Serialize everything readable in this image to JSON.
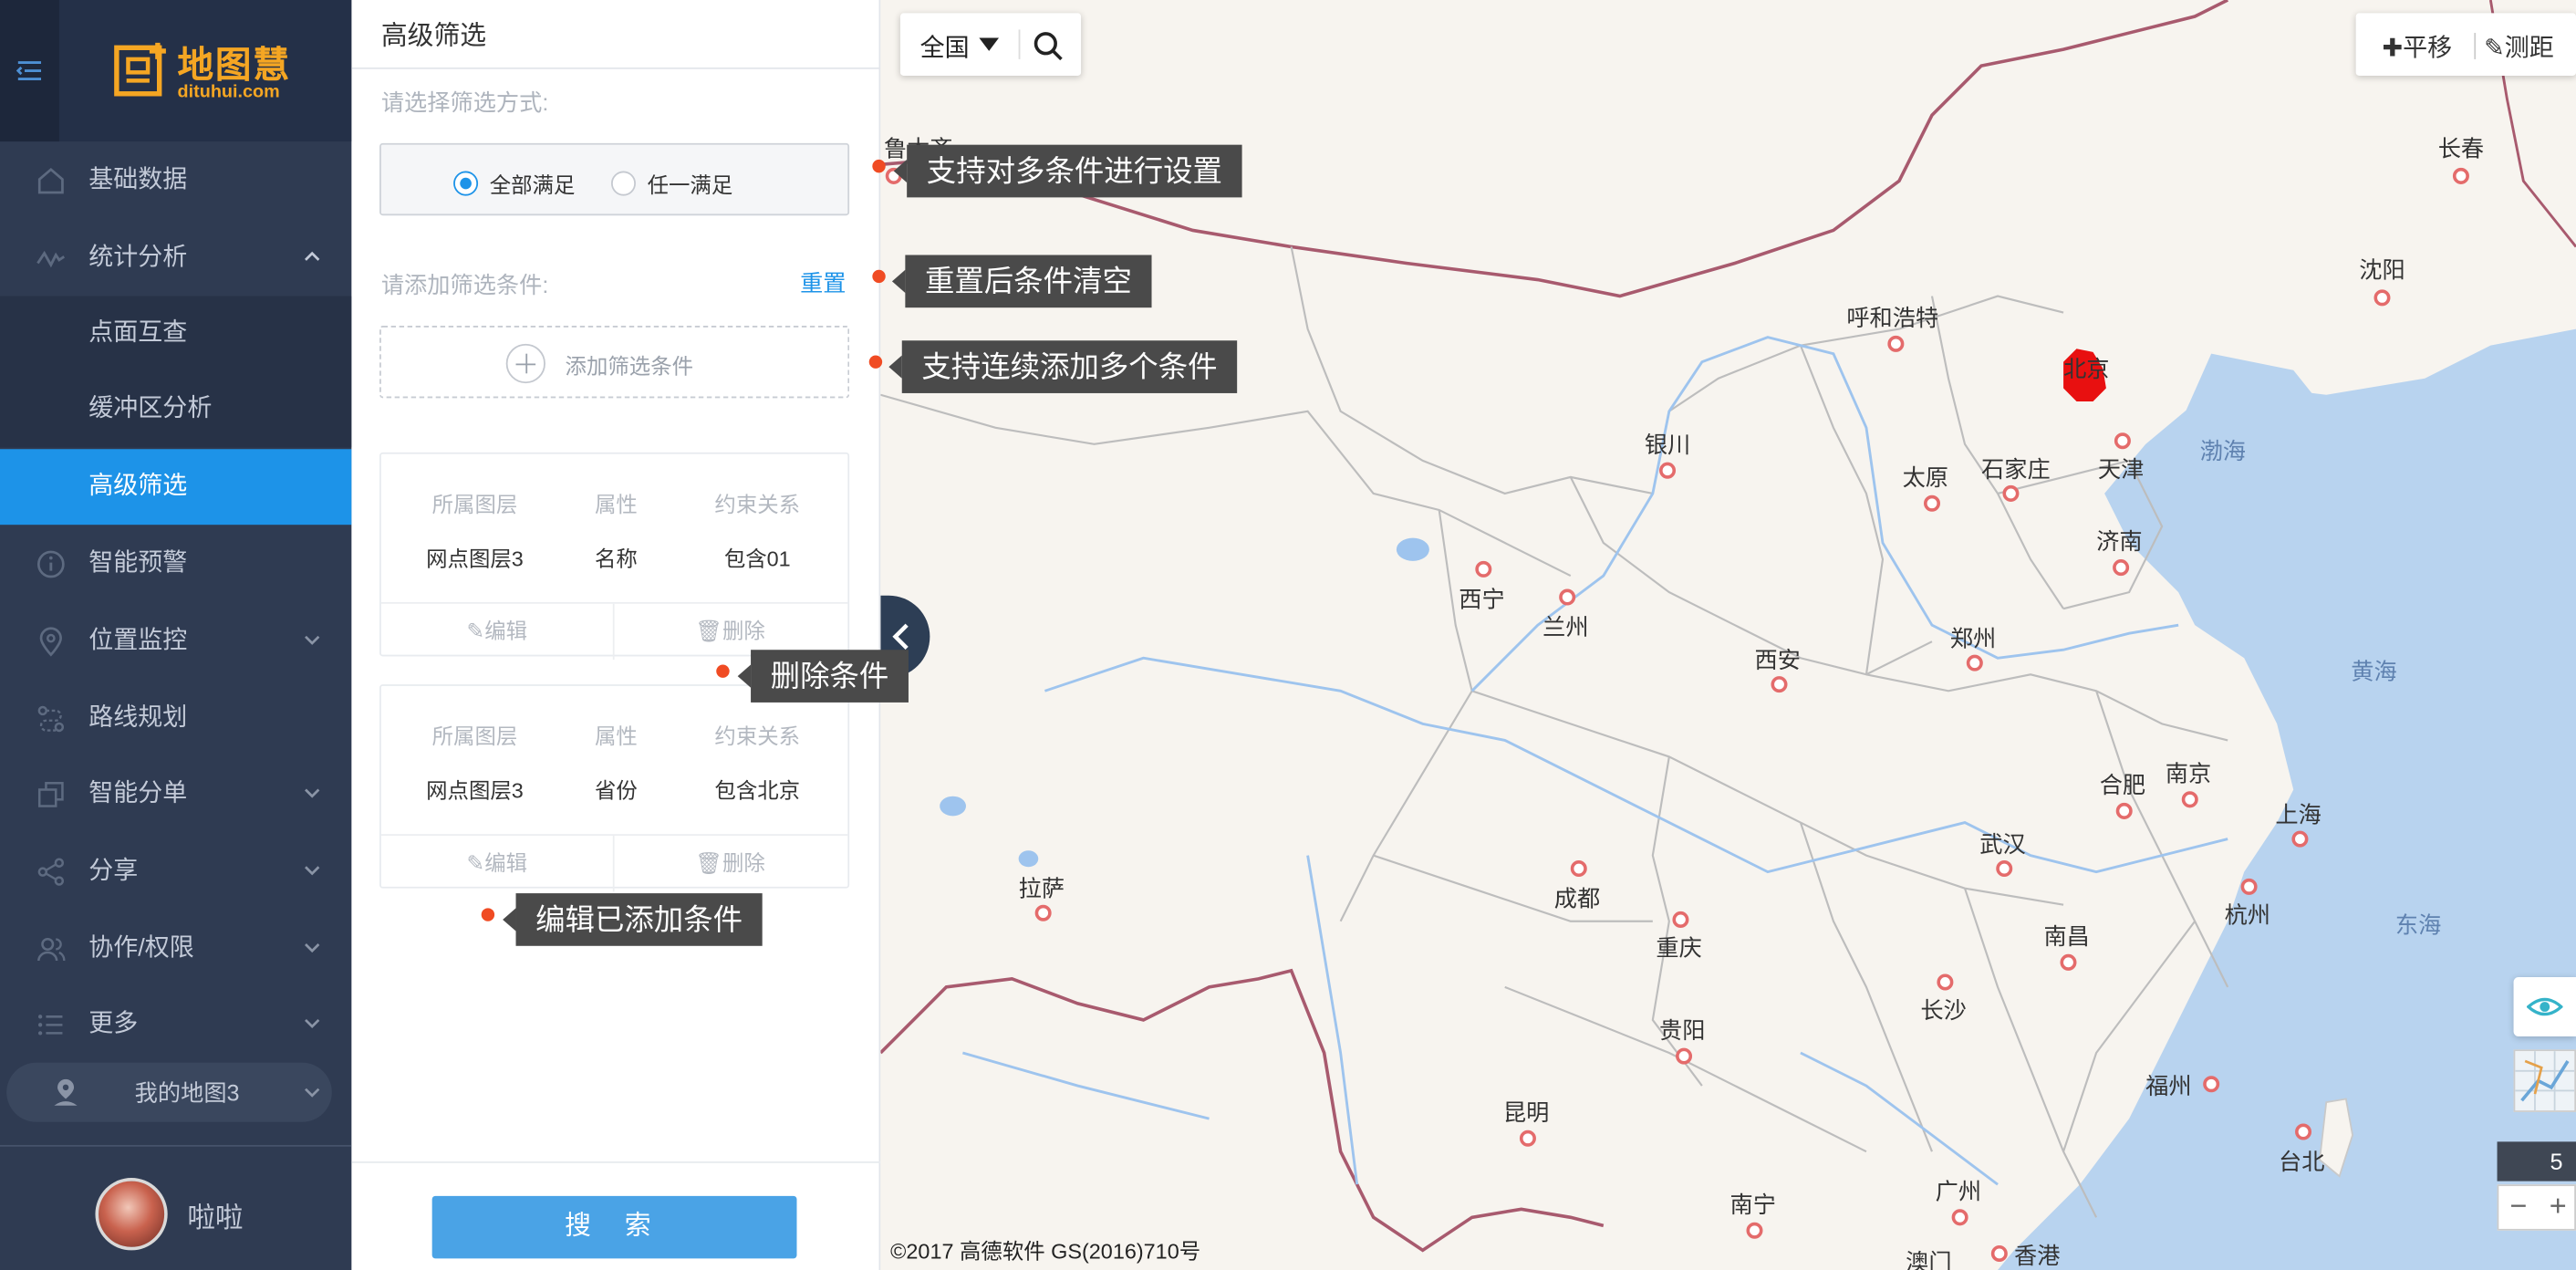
{
  "app": {
    "logo_name": "地图慧",
    "logo_url": "dituhui.com"
  },
  "sidebar": {
    "items": [
      {
        "label": "基础数据",
        "icon": "home-icon"
      },
      {
        "label": "统计分析",
        "icon": "chart-line-icon"
      },
      {
        "label": "智能预警",
        "icon": "alert-info-icon"
      },
      {
        "label": "位置监控",
        "icon": "location-pin-icon"
      },
      {
        "label": "路线规划",
        "icon": "route-icon"
      },
      {
        "label": "智能分单",
        "icon": "copy-icon"
      },
      {
        "label": "分享",
        "icon": "share-icon"
      },
      {
        "label": "协作/权限",
        "icon": "users-icon"
      },
      {
        "label": "更多",
        "icon": "list-icon"
      }
    ],
    "subitems": [
      {
        "label": "点面互查"
      },
      {
        "label": "缓冲区分析"
      },
      {
        "label": "高级筛选",
        "active": true
      }
    ],
    "my_map": "我的地图3",
    "user_name": "啦啦"
  },
  "panel": {
    "title": "高级筛选",
    "mode_label": "请选择筛选方式:",
    "mode_options": [
      {
        "label": "全部满足",
        "selected": true
      },
      {
        "label": "任一满足",
        "selected": false
      }
    ],
    "cond_label": "请添加筛选条件:",
    "reset": "重置",
    "add_condition": "添加筛选条件",
    "headers": {
      "layer": "所属图层",
      "attr": "属性",
      "relation": "约束关系"
    },
    "conditions": [
      {
        "layer": "网点图层3",
        "attr": "名称",
        "relation": "包含01"
      },
      {
        "layer": "网点图层3",
        "attr": "省份",
        "relation": "包含北京"
      }
    ],
    "edit": "编辑",
    "delete": "删除",
    "search": "搜 索"
  },
  "callouts": [
    "支持对多条件进行设置",
    "重置后条件清空",
    "支持连续添加多个条件",
    "删除条件",
    "编辑已添加条件"
  ],
  "map": {
    "region": "全国",
    "tools": {
      "pan": "平移",
      "measure": "测距"
    },
    "zoom": "5",
    "copyright": "©2017 高德软件 GS(2016)710号",
    "cities": [
      "鲁木齐",
      "长春",
      "沈阳",
      "呼和浩特",
      "北京",
      "天津",
      "石家庄",
      "太原",
      "银川",
      "济南",
      "西宁",
      "兰州",
      "郑州",
      "西安",
      "合肥",
      "南京",
      "上海",
      "武汉",
      "拉萨",
      "成都",
      "杭州",
      "重庆",
      "长沙",
      "南昌",
      "贵阳",
      "福州",
      "昆明",
      "台北",
      "南宁",
      "广州",
      "澳门",
      "香港"
    ],
    "seas": [
      "渤海",
      "黄海",
      "东海"
    ]
  },
  "colors": {
    "sidebar_bg": "#2f3b52",
    "active": "#1d93e8",
    "search_btn": "#4aa3e6",
    "callout_bg": "#4a4a4a",
    "callout_dot": "#f04b23",
    "highlight_region": "#e81010"
  }
}
